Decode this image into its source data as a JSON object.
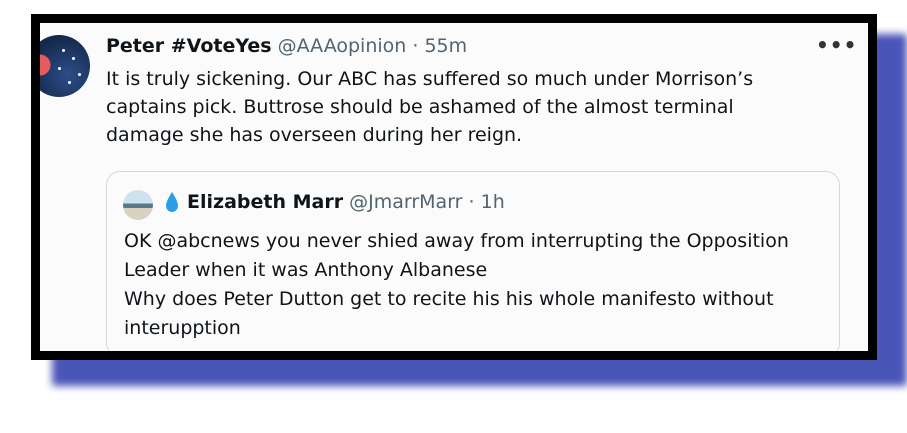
{
  "tweet": {
    "display_name": "Peter #VoteYes",
    "handle": "@AAAopinion",
    "separator": "·",
    "time": "55m",
    "more_label": "•••",
    "text_lines": [
      "It is truly sickening. Our ABC has suffered so much under Morrison’s",
      "captains pick. Buttrose should be ashamed of the almost terminal",
      "damage she has overseen during her reign."
    ]
  },
  "quoted": {
    "display_name": "Elizabeth Marr",
    "handle": "@JmarrMarr",
    "separator": "·",
    "time": "1h",
    "text_lines": [
      "OK @abcnews you never shied away from interrupting the Opposition",
      "Leader when it was Anthony Albanese",
      "Why does Peter Dutton get to recite his his whole manifesto without",
      "interupption"
    ]
  },
  "colors": {
    "frame": "#000000",
    "shadow": "#4a55b8",
    "card_bg": "#fbfbfb",
    "muted_text": "#536471",
    "drop_emoji": "#2b9fe6"
  },
  "icons": [
    "avatar",
    "more-icon",
    "water-drop-icon"
  ]
}
